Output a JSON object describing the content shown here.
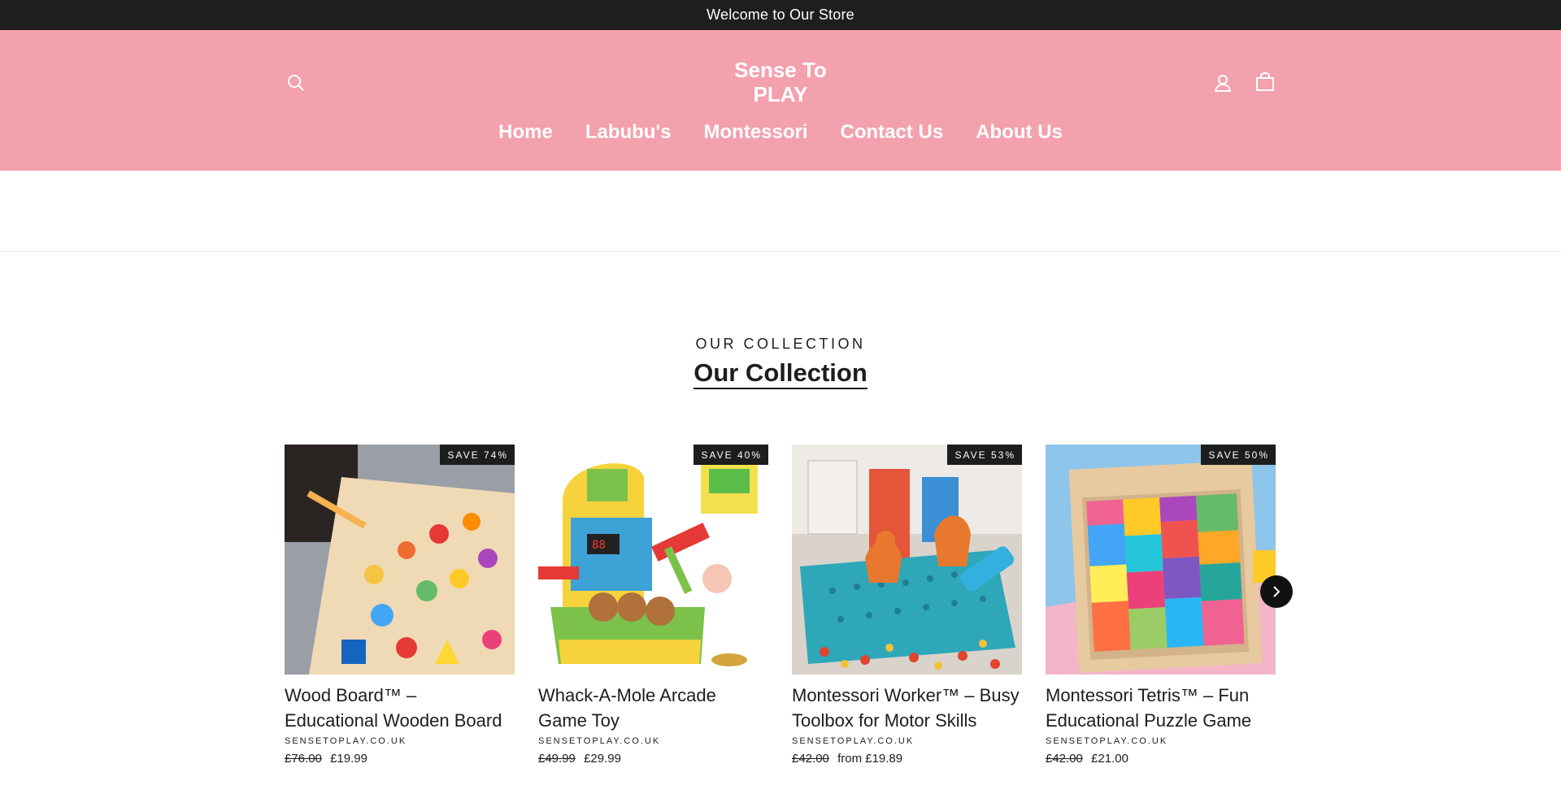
{
  "announcement": "Welcome to Our Store",
  "header": {
    "logo_line1": "Sense To",
    "logo_line2": "PLAY",
    "icons": {
      "search": "search-icon",
      "account": "user-icon",
      "cart": "bag-icon"
    },
    "nav": [
      "Home",
      "Labubu's",
      "Montessori",
      "Contact Us",
      "About Us"
    ],
    "colors": {
      "header_bg": "#f2a1ad",
      "announcement_bg": "#1e1e1e"
    }
  },
  "collection": {
    "subheading": "OUR COLLECTION",
    "heading": "Our Collection",
    "next_icon": "chevron-right-icon",
    "products": [
      {
        "badge": "SAVE 74%",
        "title": "Wood Board™ – Educational Wooden Board",
        "vendor": "SENSETOPLAY.CO.UK",
        "compare_price": "£76.00",
        "price": "£19.99"
      },
      {
        "badge": "SAVE 40%",
        "title": "Whack-A-Mole Arcade Game Toy",
        "vendor": "SENSETOPLAY.CO.UK",
        "compare_price": "£49.99",
        "price": "£29.99"
      },
      {
        "badge": "SAVE 53%",
        "title": "Montessori Worker™ – Busy Toolbox for Motor Skills",
        "vendor": "SENSETOPLAY.CO.UK",
        "compare_price": "£42.00",
        "price": "from £19.89"
      },
      {
        "badge": "SAVE 50%",
        "title": "Montessori Tetris™ – Fun Educational Puzzle Game",
        "vendor": "SENSETOPLAY.CO.UK",
        "compare_price": "£42.00",
        "price": "£21.00"
      }
    ]
  }
}
